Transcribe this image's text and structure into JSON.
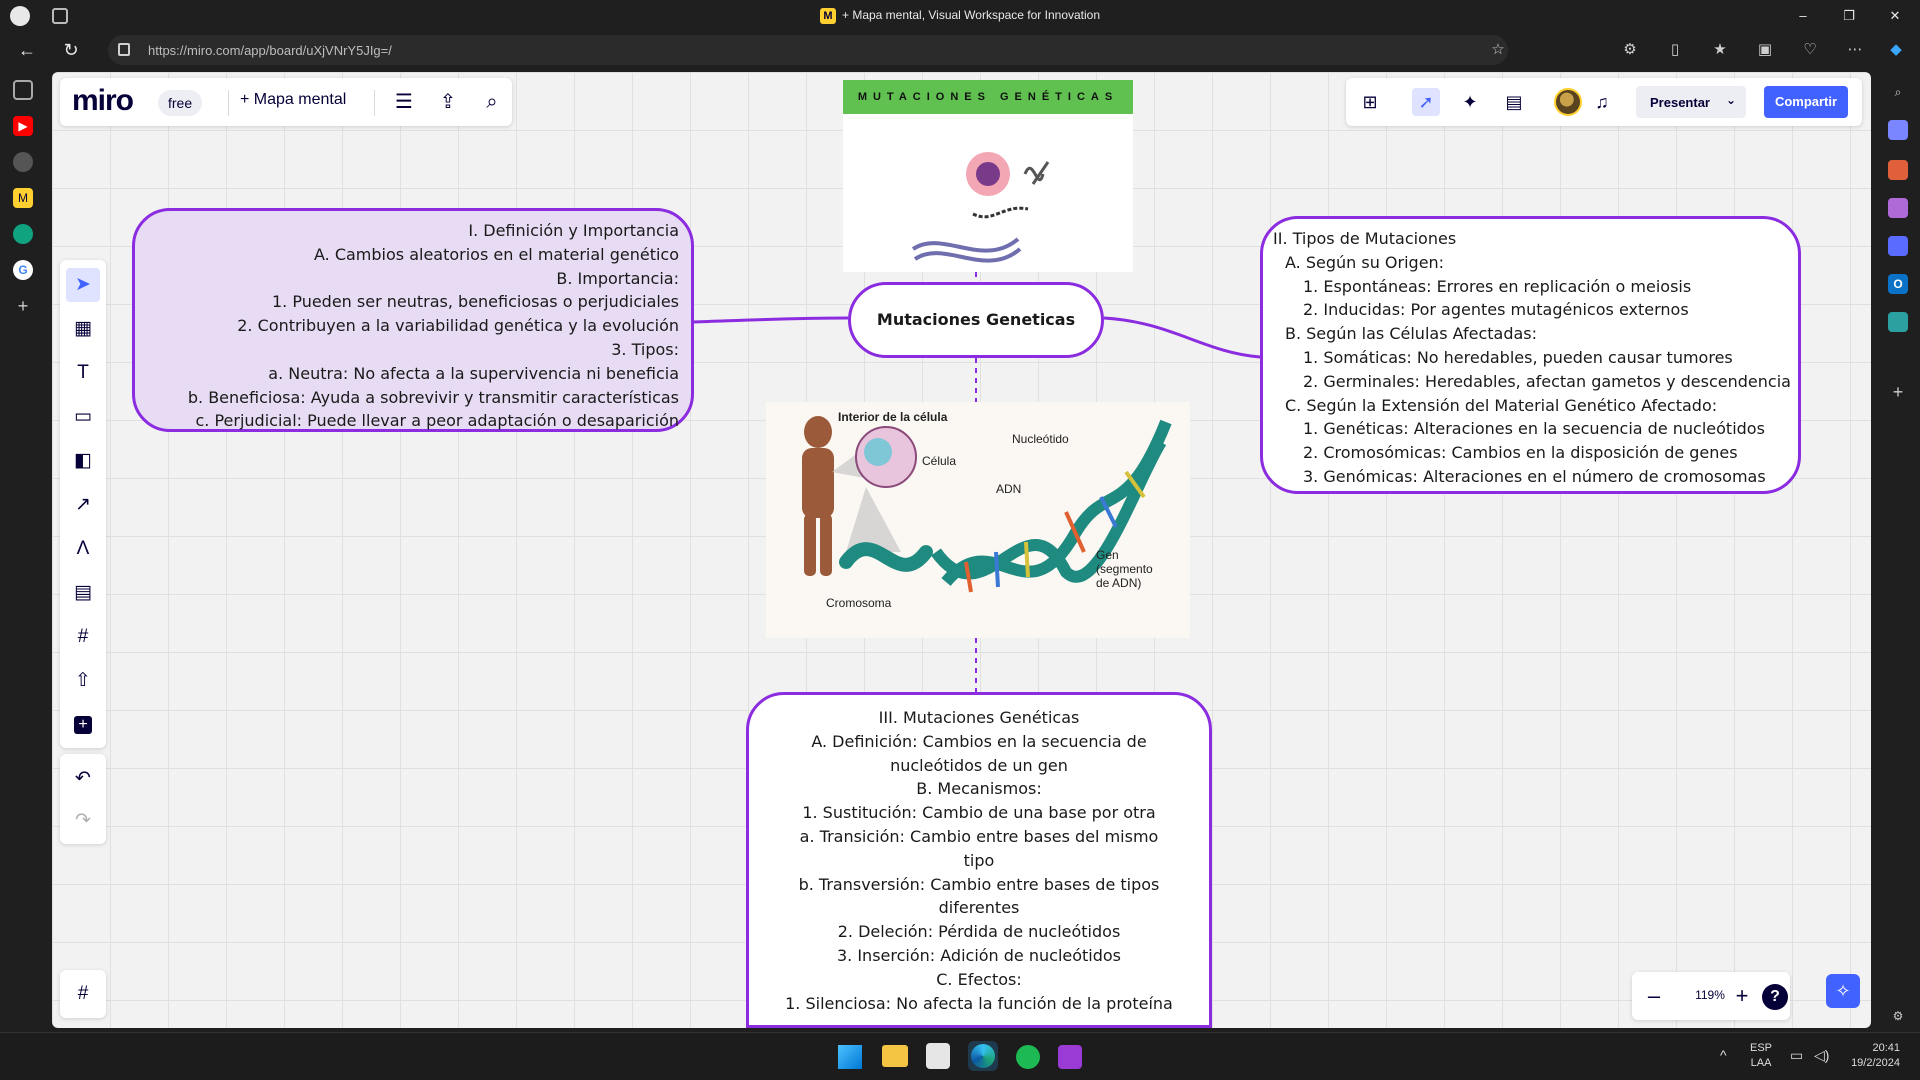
{
  "window": {
    "title": "+ Mapa mental, Visual Workspace for Innovation",
    "url": "https://miro.com/app/board/uXjVNrY5JIg=/",
    "controls": [
      "–",
      "❐",
      "✕"
    ]
  },
  "board": {
    "logo": "miro",
    "plan": "free",
    "name": "+ Mapa mental"
  },
  "header": {
    "present_label": "Presentar",
    "share_label": "Compartir"
  },
  "zoom": {
    "value": "119%",
    "minus": "–",
    "plus": "+",
    "help": "?"
  },
  "mindmap": {
    "central": "Mutaciones Geneticas",
    "left_node": [
      "I. Definición y Importancia",
      "A. Cambios aleatorios en el material genético",
      "B. Importancia:",
      "1. Pueden ser neutras, beneficiosas o perjudiciales",
      "2. Contribuyen a la variabilidad genética y la evolución",
      "3. Tipos:",
      "a. Neutra: No afecta a la supervivencia ni beneficia",
      "b. Beneficiosa: Ayuda a sobrevivir y transmitir características",
      "c. Perjudicial: Puede llevar a peor adaptación o desaparición"
    ],
    "right_node": [
      "II. Tipos de Mutaciones",
      "A. Según su Origen:",
      "1. Espontáneas: Errores en replicación o meiosis",
      "2. Inducidas: Por agentes mutagénicos externos",
      "B. Según las Células Afectadas:",
      "1. Somáticas: No heredables, pueden causar tumores",
      "2. Germinales: Heredables, afectan gametos y descendencia",
      "C. Según la Extensión del Material Genético Afectado:",
      "1. Genéticas: Alteraciones en la secuencia de nucleótidos",
      "2. Cromosómicas: Cambios en la disposición de genes",
      "3. Genómicas: Alteraciones en el número de cromosomas"
    ],
    "bottom_node": [
      "III. Mutaciones Genéticas",
      "A. Definición: Cambios en la secuencia de nucleótidos de un gen",
      "B. Mecanismos:",
      "1. Sustitución: Cambio de una base por otra",
      "a. Transición: Cambio entre bases del mismo tipo",
      "b. Transversión: Cambio entre bases de tipos diferentes",
      "2. Deleción: Pérdida de nucleótidos",
      "3. Inserción: Adición de nucleótidos",
      "C. Efectos:",
      "1. Silenciosa: No afecta la función de la proteína"
    ]
  },
  "image_top": {
    "banner": "MUTACIONES GENÉTICAS"
  },
  "image_dna": {
    "labels": {
      "interior": "Interior de la célula",
      "cell": "Célula",
      "nucleotide": "Nucleótido",
      "dna": "ADN",
      "gene": "Gen (segmento de ADN)",
      "chromosome": "Cromosoma"
    }
  },
  "taskbar": {
    "lang": "ESP",
    "layout": "LAA",
    "time": "20:41",
    "date": "19/2/2024"
  },
  "colors": {
    "accent": "#4262ff",
    "node_border": "#8b2ce0",
    "node_fill_left": "#e7dcf3"
  }
}
